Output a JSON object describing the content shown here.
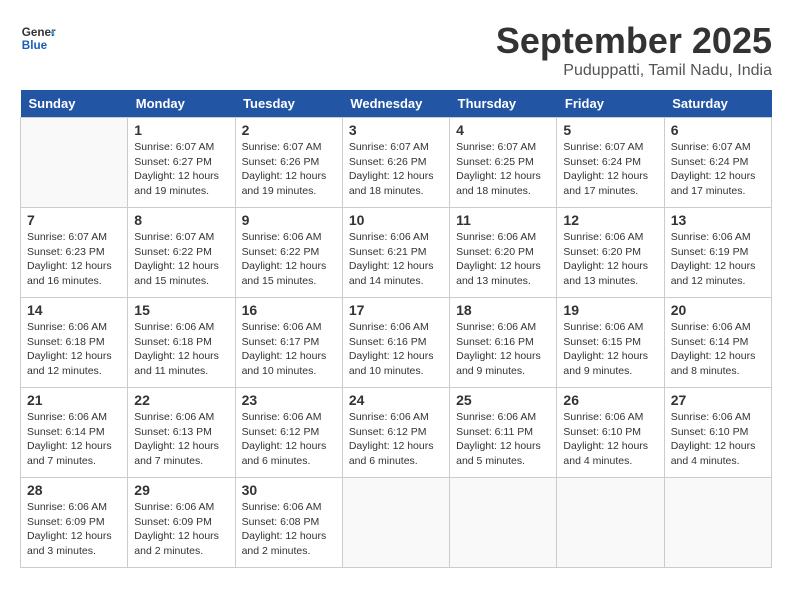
{
  "header": {
    "logo_line1": "General",
    "logo_line2": "Blue",
    "month": "September 2025",
    "location": "Puduppatti, Tamil Nadu, India"
  },
  "days_of_week": [
    "Sunday",
    "Monday",
    "Tuesday",
    "Wednesday",
    "Thursday",
    "Friday",
    "Saturday"
  ],
  "weeks": [
    [
      {
        "date": "",
        "info": ""
      },
      {
        "date": "1",
        "info": "Sunrise: 6:07 AM\nSunset: 6:27 PM\nDaylight: 12 hours\nand 19 minutes."
      },
      {
        "date": "2",
        "info": "Sunrise: 6:07 AM\nSunset: 6:26 PM\nDaylight: 12 hours\nand 19 minutes."
      },
      {
        "date": "3",
        "info": "Sunrise: 6:07 AM\nSunset: 6:26 PM\nDaylight: 12 hours\nand 18 minutes."
      },
      {
        "date": "4",
        "info": "Sunrise: 6:07 AM\nSunset: 6:25 PM\nDaylight: 12 hours\nand 18 minutes."
      },
      {
        "date": "5",
        "info": "Sunrise: 6:07 AM\nSunset: 6:24 PM\nDaylight: 12 hours\nand 17 minutes."
      },
      {
        "date": "6",
        "info": "Sunrise: 6:07 AM\nSunset: 6:24 PM\nDaylight: 12 hours\nand 17 minutes."
      }
    ],
    [
      {
        "date": "7",
        "info": "Sunrise: 6:07 AM\nSunset: 6:23 PM\nDaylight: 12 hours\nand 16 minutes."
      },
      {
        "date": "8",
        "info": "Sunrise: 6:07 AM\nSunset: 6:22 PM\nDaylight: 12 hours\nand 15 minutes."
      },
      {
        "date": "9",
        "info": "Sunrise: 6:06 AM\nSunset: 6:22 PM\nDaylight: 12 hours\nand 15 minutes."
      },
      {
        "date": "10",
        "info": "Sunrise: 6:06 AM\nSunset: 6:21 PM\nDaylight: 12 hours\nand 14 minutes."
      },
      {
        "date": "11",
        "info": "Sunrise: 6:06 AM\nSunset: 6:20 PM\nDaylight: 12 hours\nand 13 minutes."
      },
      {
        "date": "12",
        "info": "Sunrise: 6:06 AM\nSunset: 6:20 PM\nDaylight: 12 hours\nand 13 minutes."
      },
      {
        "date": "13",
        "info": "Sunrise: 6:06 AM\nSunset: 6:19 PM\nDaylight: 12 hours\nand 12 minutes."
      }
    ],
    [
      {
        "date": "14",
        "info": "Sunrise: 6:06 AM\nSunset: 6:18 PM\nDaylight: 12 hours\nand 12 minutes."
      },
      {
        "date": "15",
        "info": "Sunrise: 6:06 AM\nSunset: 6:18 PM\nDaylight: 12 hours\nand 11 minutes."
      },
      {
        "date": "16",
        "info": "Sunrise: 6:06 AM\nSunset: 6:17 PM\nDaylight: 12 hours\nand 10 minutes."
      },
      {
        "date": "17",
        "info": "Sunrise: 6:06 AM\nSunset: 6:16 PM\nDaylight: 12 hours\nand 10 minutes."
      },
      {
        "date": "18",
        "info": "Sunrise: 6:06 AM\nSunset: 6:16 PM\nDaylight: 12 hours\nand 9 minutes."
      },
      {
        "date": "19",
        "info": "Sunrise: 6:06 AM\nSunset: 6:15 PM\nDaylight: 12 hours\nand 9 minutes."
      },
      {
        "date": "20",
        "info": "Sunrise: 6:06 AM\nSunset: 6:14 PM\nDaylight: 12 hours\nand 8 minutes."
      }
    ],
    [
      {
        "date": "21",
        "info": "Sunrise: 6:06 AM\nSunset: 6:14 PM\nDaylight: 12 hours\nand 7 minutes."
      },
      {
        "date": "22",
        "info": "Sunrise: 6:06 AM\nSunset: 6:13 PM\nDaylight: 12 hours\nand 7 minutes."
      },
      {
        "date": "23",
        "info": "Sunrise: 6:06 AM\nSunset: 6:12 PM\nDaylight: 12 hours\nand 6 minutes."
      },
      {
        "date": "24",
        "info": "Sunrise: 6:06 AM\nSunset: 6:12 PM\nDaylight: 12 hours\nand 6 minutes."
      },
      {
        "date": "25",
        "info": "Sunrise: 6:06 AM\nSunset: 6:11 PM\nDaylight: 12 hours\nand 5 minutes."
      },
      {
        "date": "26",
        "info": "Sunrise: 6:06 AM\nSunset: 6:10 PM\nDaylight: 12 hours\nand 4 minutes."
      },
      {
        "date": "27",
        "info": "Sunrise: 6:06 AM\nSunset: 6:10 PM\nDaylight: 12 hours\nand 4 minutes."
      }
    ],
    [
      {
        "date": "28",
        "info": "Sunrise: 6:06 AM\nSunset: 6:09 PM\nDaylight: 12 hours\nand 3 minutes."
      },
      {
        "date": "29",
        "info": "Sunrise: 6:06 AM\nSunset: 6:09 PM\nDaylight: 12 hours\nand 2 minutes."
      },
      {
        "date": "30",
        "info": "Sunrise: 6:06 AM\nSunset: 6:08 PM\nDaylight: 12 hours\nand 2 minutes."
      },
      {
        "date": "",
        "info": ""
      },
      {
        "date": "",
        "info": ""
      },
      {
        "date": "",
        "info": ""
      },
      {
        "date": "",
        "info": ""
      }
    ]
  ]
}
